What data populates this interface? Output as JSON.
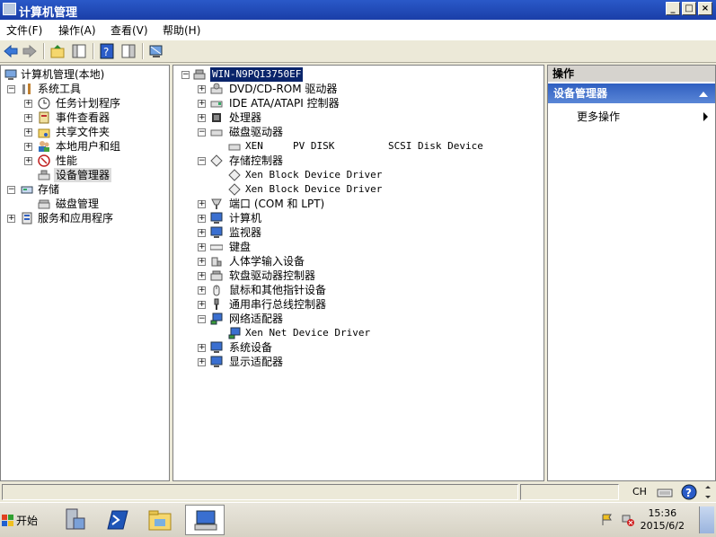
{
  "window": {
    "title": "计算机管理"
  },
  "window_buttons": [
    "_",
    "□",
    "×"
  ],
  "menubar": [
    "文件(F)",
    "操作(A)",
    "查看(V)",
    "帮助(H)"
  ],
  "left_tree": {
    "root": "计算机管理(本地)",
    "system_tools": "系统工具",
    "task_scheduler": "任务计划程序",
    "event_viewer": "事件查看器",
    "shared_folders": "共享文件夹",
    "local_users": "本地用户和组",
    "performance": "性能",
    "device_manager": "设备管理器",
    "storage": "存储",
    "disk_management": "磁盘管理",
    "services_apps": "服务和应用程序"
  },
  "device_tree": {
    "host": "WIN-N9PQI3750EF",
    "dvd": "DVD/CD-ROM 驱动器",
    "ide": "IDE ATA/ATAPI 控制器",
    "processor": "处理器",
    "disk_drives": "磁盘驱动器",
    "disk_child": "XEN     PV DISK         SCSI Disk Device",
    "storage_ctrl": "存储控制器",
    "xen_block_1": "Xen Block Device Driver",
    "xen_block_2": "Xen Block Device Driver",
    "ports": "端口 (COM 和 LPT)",
    "computer": "计算机",
    "monitors": "监视器",
    "keyboards": "键盘",
    "hid": "人体学输入设备",
    "floppy_ctrl": "软盘驱动器控制器",
    "mice": "鼠标和其他指针设备",
    "usb": "通用串行总线控制器",
    "network": "网络适配器",
    "xen_net": "Xen Net Device Driver",
    "system_devices": "系统设备",
    "display": "显示适配器"
  },
  "actions": {
    "header": "操作",
    "section": "设备管理器",
    "more": "更多操作"
  },
  "taskbar": {
    "start": "开始",
    "language": "CH",
    "time": "15:36",
    "date": "2015/6/2"
  },
  "colors": {
    "title_bar": "#1a3ea8",
    "selection": "#0a246a",
    "action_section": "#2f5fc0"
  }
}
